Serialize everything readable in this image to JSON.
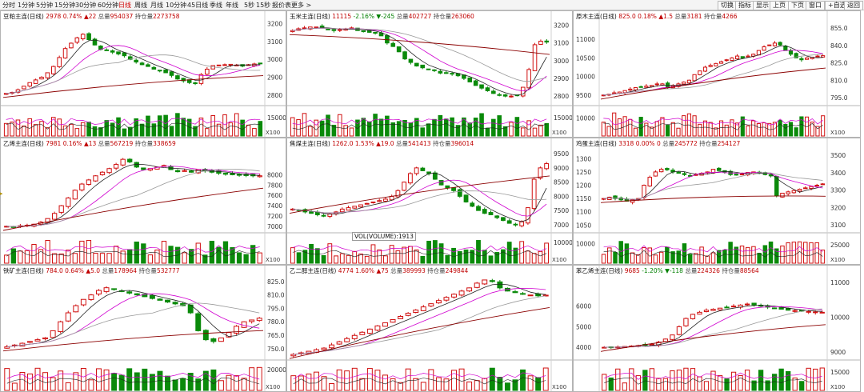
{
  "toolbar": {
    "left_items": [
      "分时",
      "1分钟",
      "5分钟",
      "15分钟",
      "30分钟",
      "60分钟",
      "日线",
      "周线",
      "月线",
      "10分钟",
      "45日线",
      "季线",
      "年线",
      "5秒",
      "15秒",
      "报价表",
      "更多 >"
    ],
    "active_item": "日线",
    "right_items": [
      "切换",
      "指标",
      "显示",
      "上页",
      "下页",
      "窗口",
      "+自选",
      "返回"
    ]
  },
  "volume_indicator_label": "VOL(VOLUME):1913",
  "volume_scale_tag": "X100",
  "colors": {
    "up": "#d01010",
    "down": "#0a8a0a",
    "ma5": "#222222",
    "ma10": "#d000d0",
    "ma20": "#999999",
    "ma60": "#8b0000"
  },
  "chart_data": [
    {
      "type": "candlestick",
      "name": "豆粕主连(日线)",
      "price_text": "2978",
      "change_text": "0.74%",
      "change_abs": "▲22",
      "volume_label": "总量",
      "volume_value": "954037",
      "oi_label": "持仓量",
      "oi_value": "2273758",
      "price_ticks": [
        "3200",
        "3100",
        "3000",
        "2900",
        "2800"
      ],
      "price_range": [
        2755,
        3215
      ],
      "volume_ticks": [
        "15000"
      ],
      "volume_max": 22000,
      "closes": [
        2810,
        2815,
        2830,
        2850,
        2870,
        2885,
        2900,
        2925,
        2960,
        3010,
        3060,
        3090,
        3120,
        3140,
        3110,
        3080,
        3055,
        3050,
        3040,
        3030,
        3020,
        3000,
        2985,
        2970,
        2960,
        2945,
        2935,
        2925,
        2910,
        2890,
        2880,
        2870,
        2865,
        2915,
        2945,
        2965,
        2968,
        2970,
        2972,
        2968,
        2962,
        2970,
        2974,
        2978
      ]
    },
    {
      "type": "candlestick",
      "name": "玉米主连(日线)",
      "price_text": "11115",
      "change_text": "-2.16%",
      "change_abs": "▼-245",
      "volume_label": "总量",
      "volume_value": "402727",
      "oi_label": "持仓量",
      "oi_value": "263060",
      "price_ticks": [
        "3200",
        "3100",
        "3000",
        "2900",
        "2800"
      ],
      "price_range": [
        2760,
        3225
      ],
      "volume_ticks": [
        "15000"
      ],
      "volume_max": 22000,
      "closes": [
        3170,
        3180,
        3185,
        3190,
        3190,
        3185,
        3175,
        3170,
        3175,
        3180,
        3185,
        3170,
        3165,
        3160,
        3155,
        3140,
        3100,
        3080,
        3050,
        3010,
        2990,
        2970,
        2960,
        2950,
        2945,
        2930,
        2930,
        2925,
        2915,
        2900,
        2880,
        2860,
        2845,
        2830,
        2815,
        2805,
        2800,
        2800,
        2805,
        2850,
        2950,
        3090,
        3110,
        3105
      ]
    },
    {
      "type": "candlestick",
      "name": "原木主连(日线)",
      "price_text": "825.0",
      "change_text": "0.18%",
      "change_abs": "▲1.5",
      "volume_label": "总量",
      "volume_value": "3181",
      "oi_label": "持仓量",
      "oi_value": "4266",
      "price_ticks": [
        "11000",
        "10500",
        "10000",
        "9500"
      ],
      "price_range": [
        9280,
        11500
      ],
      "price_ticks_right": [
        "855.0",
        "840.0",
        "825.0",
        "810.0",
        "795.0"
      ],
      "volume_ticks": [
        "10000"
      ],
      "volume_max": 15000,
      "closes": [
        9500,
        9520,
        9560,
        9580,
        9620,
        9660,
        9700,
        9720,
        9740,
        9760,
        9800,
        9800,
        9700,
        9750,
        9800,
        9850,
        9900,
        10050,
        10150,
        10250,
        10300,
        10350,
        10400,
        10450,
        10500,
        10550,
        10500,
        10550,
        10600,
        10700,
        10800,
        10850,
        10900,
        10850,
        10700,
        10600,
        10500,
        10450,
        10500,
        10520,
        10550,
        10560
      ]
    },
    {
      "type": "candlestick",
      "name": "乙烯主连(日线)",
      "price_text": "7981",
      "change_text": "0.16%",
      "change_abs": "▲13",
      "volume_label": "总量",
      "volume_value": "567219",
      "oi_label": "持仓量",
      "oi_value": "338659",
      "price_ticks": [
        "8000",
        "7800",
        "7600",
        "7400",
        "7200",
        "7000"
      ],
      "price_range": [
        6920,
        8520
      ],
      "volume_ticks": [],
      "volume_max": 16000,
      "closes": [
        7000,
        6990,
        7010,
        7020,
        7040,
        7080,
        7150,
        7250,
        7400,
        7550,
        7700,
        7820,
        7900,
        7980,
        8050,
        8120,
        8200,
        8300,
        8250,
        8150,
        8100,
        8120,
        8150,
        8180,
        8100,
        8060,
        8080,
        8050,
        8100,
        8080,
        8050,
        8030,
        8010,
        8000,
        7990,
        7985,
        7980,
        7981
      ]
    },
    {
      "type": "candlestick",
      "name": "焦煤主连(日线)",
      "price_text": "1262.0",
      "change_text": "1.53%",
      "change_abs": "▲19.0",
      "volume_label": "总量",
      "volume_value": "541413",
      "oi_label": "持仓量",
      "oi_value": "396014",
      "price_ticks": [
        "9500",
        "9000",
        "8500",
        "8000",
        "7500",
        "7000"
      ],
      "price_range": [
        6800,
        9700
      ],
      "volume_ticks": [
        "10000"
      ],
      "volume_max": 13000,
      "closes": [
        7550,
        7500,
        7450,
        7400,
        7350,
        7300,
        7380,
        7450,
        7550,
        7600,
        7650,
        7700,
        7750,
        7800,
        7850,
        7900,
        8000,
        8200,
        8500,
        8800,
        9000,
        8900,
        8800,
        8600,
        8400,
        8300,
        8200,
        8000,
        7800,
        7650,
        7500,
        7400,
        7350,
        7250,
        7150,
        7050,
        7000,
        7100,
        7600,
        8600,
        9000,
        9150
      ]
    },
    {
      "type": "candlestick",
      "name": "鸡蛋主连(日线)",
      "price_text": "3318",
      "change_text": "0.00%",
      "change_abs": "0",
      "volume_label": "总量",
      "volume_value": "245772",
      "oi_label": "持仓量",
      "oi_value": "254127",
      "price_ticks": [
        "1300",
        "1250",
        "1200",
        "1150",
        "1100",
        "1050"
      ],
      "price_range": [
        1030,
        1340
      ],
      "price_ticks_right": [
        "3500",
        "3400",
        "3300",
        "3200",
        "3100"
      ],
      "volume_ticks": [
        "10000"
      ],
      "volume_ticks_right": [
        "25000"
      ],
      "volume_max": 14000,
      "closes": [
        1150,
        1155,
        1150,
        1145,
        1140,
        1145,
        1150,
        1200,
        1230,
        1250,
        1260,
        1258,
        1250,
        1245,
        1240,
        1235,
        1240,
        1245,
        1250,
        1260,
        1255,
        1250,
        1240,
        1238,
        1242,
        1248,
        1250,
        1245,
        1240,
        1235,
        1160,
        1170,
        1175,
        1180,
        1185,
        1190,
        1195,
        1200,
        1205
      ]
    },
    {
      "type": "candlestick",
      "name": "铁矿主连(日线)",
      "price_text": "784.0",
      "change_text": "0.64%",
      "change_abs": "▲5.0",
      "volume_label": "总量",
      "volume_value": "178964",
      "oi_label": "持仓量",
      "oi_value": "532777",
      "price_ticks": [
        "825.0",
        "810.0",
        "795.0",
        "780.0",
        "765.0",
        "750.0"
      ],
      "price_range": [
        740,
        832
      ],
      "volume_ticks": [
        "20000"
      ],
      "volume_max": 26000,
      "closes": [
        752,
        754,
        756,
        758,
        760,
        762,
        770,
        780,
        790,
        798,
        805,
        810,
        815,
        818,
        816,
        814,
        812,
        810,
        808,
        806,
        804,
        802,
        800,
        798,
        790,
        770,
        760,
        758,
        762,
        768,
        775,
        780,
        782,
        784
      ]
    },
    {
      "type": "candlestick",
      "name": "乙二醇主连(日线)",
      "price_text": "4774",
      "change_text": "1.60%",
      "change_abs": "▲75",
      "volume_label": "总量",
      "volume_value": "389993",
      "oi_label": "持仓量",
      "oi_value": "249844",
      "price_ticks": [],
      "price_range": [
        4380,
        4900
      ],
      "volume_ticks": [],
      "volume_max": 15000,
      "closes": [
        4400,
        4410,
        4420,
        4430,
        4440,
        4460,
        4480,
        4500,
        4520,
        4540,
        4560,
        4580,
        4600,
        4620,
        4640,
        4660,
        4680,
        4700,
        4720,
        4740,
        4760,
        4780,
        4800,
        4820,
        4850,
        4870,
        4860,
        4820,
        4800,
        4790,
        4780,
        4775,
        4770,
        4774
      ]
    },
    {
      "type": "candlestick",
      "name": "苯乙烯主连(日线)",
      "price_text": "9685",
      "change_text": "-1.20%",
      "change_abs": "▼-118",
      "volume_label": "总量",
      "volume_value": "224326",
      "oi_label": "持仓量",
      "oi_value": "88564",
      "price_ticks": [
        "6000",
        "5000",
        "4000"
      ],
      "price_range": [
        3500,
        7500
      ],
      "price_ticks_right": [
        "11000",
        "10000",
        "9000"
      ],
      "volume_ticks": [],
      "volume_ticks_right": [
        "15000"
      ],
      "volume_max": 19000,
      "closes": [
        4000,
        4010,
        4020,
        4040,
        4060,
        4080,
        4100,
        4150,
        4250,
        4400,
        4600,
        5000,
        5400,
        5600,
        5700,
        5800,
        5850,
        5900,
        5950,
        6000,
        6050,
        6100,
        6050,
        6000,
        5950,
        5900,
        5850,
        5800,
        5780,
        5760,
        5740,
        5720,
        5700
      ]
    }
  ]
}
